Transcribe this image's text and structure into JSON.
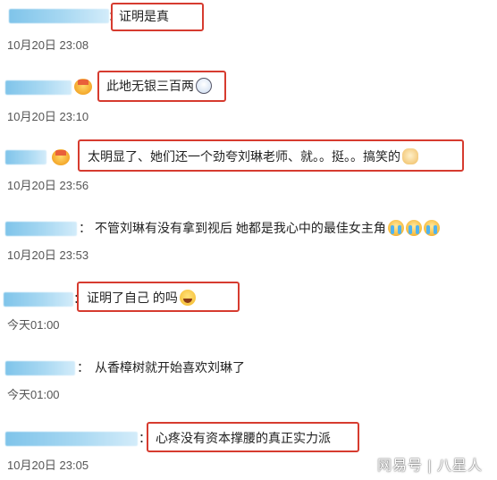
{
  "comments": [
    {
      "text": "证明是真",
      "time": "10月20日 23:08"
    },
    {
      "text": "此地无银三百两",
      "time": "10月20日 23:10"
    },
    {
      "text": "太明显了、她们还一个劲夸刘琳老师、就。。挺。。搞笑的",
      "time": "10月20日 23:56"
    },
    {
      "text": "不管刘琳有没有拿到视后 她都是我心中的最佳女主角",
      "time": "10月20日 23:53"
    },
    {
      "text": "证明了自己 的吗",
      "time": "今天01:00"
    },
    {
      "text": "从香樟树就开始喜欢刘琳了",
      "time": "今天01:00"
    },
    {
      "text": "心疼没有资本撑腰的真正实力派",
      "time": "10月20日 23:05"
    }
  ],
  "colon": "：",
  "watermark": "网易号 | 八星人",
  "colors": {
    "highlight_border": "#d63b2f",
    "username_blur": "#7fc4ea"
  },
  "icons": [
    "crown-badge-icon",
    "shocked-face-emoji",
    "dog-laugh-emoji",
    "crying-face-emoji",
    "laughing-face-emoji"
  ]
}
